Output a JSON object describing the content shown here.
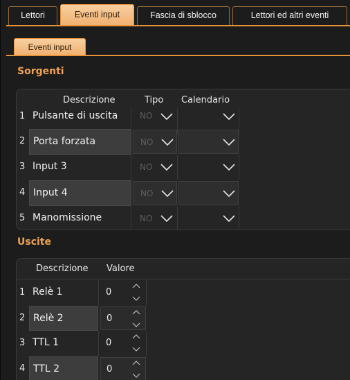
{
  "tabs": [
    {
      "label": "Lettori",
      "active": false
    },
    {
      "label": "Eventi input",
      "active": true
    },
    {
      "label": "Fascia di sblocco",
      "active": false
    },
    {
      "label": "Lettori ed altri eventi",
      "active": false
    }
  ],
  "sub_tab": {
    "label": "Eventi input"
  },
  "sorgenti": {
    "title": "Sorgenti",
    "headers": {
      "descrizione": "Descrizione",
      "tipo": "Tipo",
      "calendario": "Calendario"
    },
    "rows": [
      {
        "num": "1",
        "descrizione": "Pulsante di uscita",
        "tipo": "NO",
        "calendario": ""
      },
      {
        "num": "2",
        "descrizione": "Porta forzata",
        "tipo": "NO",
        "calendario": ""
      },
      {
        "num": "3",
        "descrizione": "Input 3",
        "tipo": "NO",
        "calendario": ""
      },
      {
        "num": "4",
        "descrizione": "Input 4",
        "tipo": "NO",
        "calendario": ""
      },
      {
        "num": "5",
        "descrizione": "Manomissione",
        "tipo": "NO",
        "calendario": ""
      }
    ]
  },
  "uscite": {
    "title": "Uscite",
    "headers": {
      "descrizione": "Descrizione",
      "valore": "Valore"
    },
    "rows": [
      {
        "num": "1",
        "descrizione": "Relè 1",
        "valore": "0"
      },
      {
        "num": "2",
        "descrizione": "Relè 2",
        "valore": "0"
      },
      {
        "num": "3",
        "descrizione": "TTL 1",
        "valore": "0"
      },
      {
        "num": "4",
        "descrizione": "TTL 2",
        "valore": "0"
      }
    ]
  },
  "colors": {
    "accent": "#e8923a",
    "active_tab": "#f2b070",
    "section_title": "#f0a050",
    "background": "#1c1c1c"
  }
}
